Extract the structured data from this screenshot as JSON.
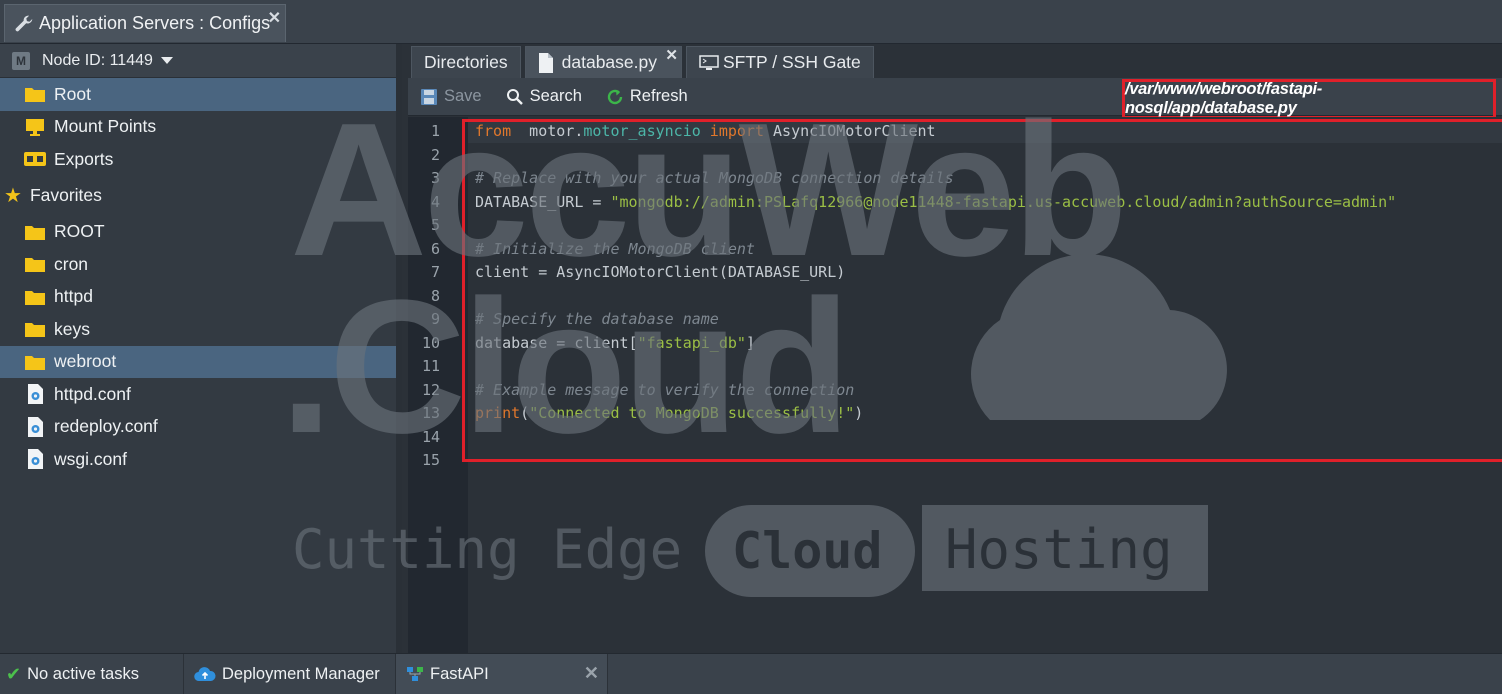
{
  "window": {
    "title": "Application Servers : Configs",
    "close": "✕"
  },
  "node": {
    "badge": "M",
    "label": "Node ID: 11449"
  },
  "tree": {
    "root_items": [
      {
        "label": "Root",
        "icon": "folder-icon",
        "selected": true
      },
      {
        "label": "Mount Points",
        "icon": "monitor-icon",
        "selected": false
      },
      {
        "label": "Exports",
        "icon": "glasses-icon",
        "selected": false
      }
    ],
    "favorites_label": "Favorites",
    "favorites": [
      {
        "label": "ROOT",
        "icon": "folder-icon",
        "selected": false
      },
      {
        "label": "cron",
        "icon": "folder-icon",
        "selected": false
      },
      {
        "label": "httpd",
        "icon": "folder-icon",
        "selected": false
      },
      {
        "label": "keys",
        "icon": "folder-icon",
        "selected": false
      },
      {
        "label": "webroot",
        "icon": "folder-icon",
        "selected": true
      },
      {
        "label": "httpd.conf",
        "icon": "config-file-icon",
        "selected": false
      },
      {
        "label": "redeploy.conf",
        "icon": "config-file-icon",
        "selected": false
      },
      {
        "label": "wsgi.conf",
        "icon": "config-file-icon",
        "selected": false
      }
    ]
  },
  "tabs": [
    {
      "label": "Directories"
    },
    {
      "label": "database.py",
      "close": "✕"
    },
    {
      "label": "SFTP / SSH Gate"
    }
  ],
  "toolbar": {
    "save_label": "Save",
    "search_label": "Search",
    "refresh_label": "Refresh",
    "path": "/var/www/webroot/fastapi-nosql/app/database.py"
  },
  "editor": {
    "line_numbers": [
      "1",
      "2",
      "3",
      "4",
      "5",
      "6",
      "7",
      "8",
      "9",
      "10",
      "11",
      "12",
      "13",
      "14",
      "15"
    ],
    "lines": [
      [
        [
          "kw",
          "from"
        ],
        [
          "",
          "  motor."
        ],
        [
          "mod",
          "motor_asyncio"
        ],
        [
          "kw",
          " import"
        ],
        [
          "",
          " AsyncIOMotorClient"
        ]
      ],
      [],
      [
        [
          "cm",
          "# Replace with your actual MongoDB connection details"
        ]
      ],
      [
        [
          "",
          "DATABASE_URL = "
        ],
        [
          "str",
          "\"mongodb://admin:PSLafq12966@node11448-fastapi.us-accuweb.cloud/admin?authSource=admin\""
        ]
      ],
      [],
      [
        [
          "cm",
          "# Initialize the MongoDB client"
        ]
      ],
      [
        [
          "",
          "client = AsyncIOMotorClient(DATABASE_URL)"
        ]
      ],
      [],
      [
        [
          "cm",
          "# Specify the database name"
        ]
      ],
      [
        [
          "",
          "database = client["
        ],
        [
          "str",
          "\"fastapi_db\""
        ],
        [
          "",
          "]"
        ]
      ],
      [],
      [
        [
          "cm",
          "# Example message to verify the connection"
        ]
      ],
      [
        [
          "kw",
          "print"
        ],
        [
          "",
          "("
        ],
        [
          "str",
          "\"Connected to MongoDB successfully!\""
        ],
        [
          "",
          ")"
        ]
      ],
      [],
      []
    ]
  },
  "watermark": {
    "line1": "AccuWeb",
    "line2": ".Cloud",
    "tagline_a": "Cutting Edge",
    "tagline_b": "Cloud",
    "tagline_c": "Hosting"
  },
  "taskbar": [
    {
      "label": "No active tasks"
    },
    {
      "label": "Deployment Manager"
    },
    {
      "label": "FastAPI",
      "close": "✕"
    }
  ],
  "colors": {
    "accent_red": "#e0202a",
    "selection": "#4a6580",
    "folder": "#f5c518"
  }
}
